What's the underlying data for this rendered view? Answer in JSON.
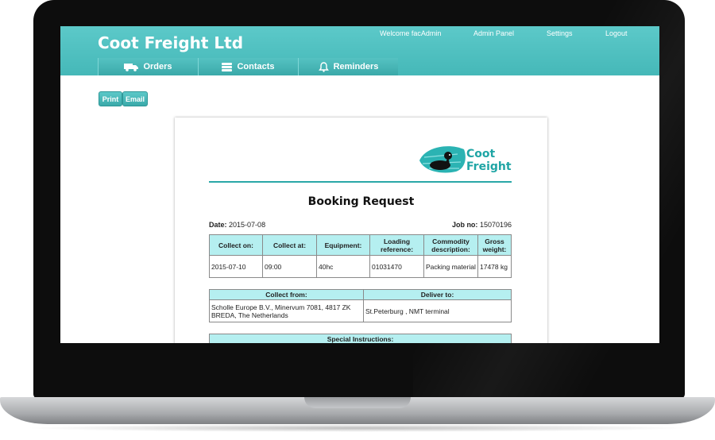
{
  "app": {
    "title": "Coot Freight Ltd",
    "welcome": "Welcome facAdmin",
    "links": [
      "Admin Panel",
      "Settings",
      "Logout"
    ],
    "accent_color": "#45b8b8"
  },
  "nav": {
    "tabs": [
      {
        "label": "Orders",
        "icon": "truck-icon"
      },
      {
        "label": "Contacts",
        "icon": "contacts-icon"
      },
      {
        "label": "Reminders",
        "icon": "bell-icon"
      }
    ]
  },
  "actions": {
    "print": "Print",
    "email": "Email"
  },
  "document": {
    "logo": {
      "line1": "Coot",
      "line2": "Freight"
    },
    "title": "Booking Request",
    "date_label": "Date:",
    "date": "2015-07-08",
    "job_label": "Job no:",
    "job_no": "15070196",
    "collection_table": {
      "headers": [
        "Collect on:",
        "Collect at:",
        "Equipment:",
        "Loading reference:",
        "Commodity description:",
        "Gross weight:"
      ],
      "row": [
        "2015-07-10",
        "09:00",
        "40hc",
        "01031470",
        "Packing material",
        "17478 kg"
      ]
    },
    "address_table": {
      "headers": [
        "Collect from:",
        "Deliver to:"
      ],
      "row": [
        "Scholle Europe B.V., Minervum 7081, 4817 ZK BREDA, The Netherlands",
        "St.Peterburg , NMT terminal"
      ]
    },
    "instructions_header": "Special Instructions:"
  }
}
